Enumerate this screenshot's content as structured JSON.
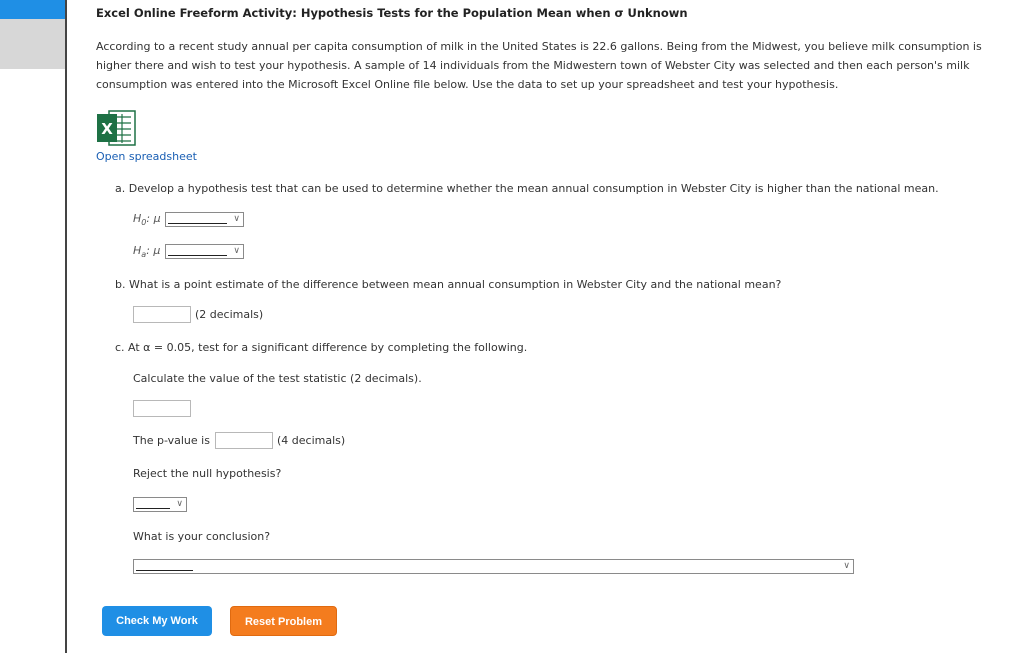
{
  "title": "Excel Online Freeform Activity: Hypothesis Tests for the Population Mean when σ Unknown",
  "intro": "According to a recent study annual per capita consumption of milk in the United States is 22.6 gallons. Being from the Midwest, you believe milk consumption is higher there and wish to test your hypothesis. A sample of 14 individuals from the Midwestern town of Webster City was selected and then each person's milk consumption was entered into the Microsoft Excel Online file below. Use the data to set up your spreadsheet and test your hypothesis.",
  "excel_icon": {
    "letter": "X",
    "icon": "excel-icon",
    "color": "#1e7145"
  },
  "open_link": "Open spreadsheet",
  "part_a": {
    "question": "a.  Develop a hypothesis test that can be used to determine whether the mean annual consumption in Webster City is higher than the national mean.",
    "h0_label": "H",
    "h0_sub": "0",
    "h0_suffix": ": μ",
    "ha_label": "H",
    "ha_sub": "a",
    "ha_suffix": ": μ"
  },
  "part_b": {
    "question": "b.  What is a point estimate of the difference between mean annual consumption in Webster City and the national mean?",
    "hint": "(2 decimals)"
  },
  "part_c": {
    "question": "c.  At α = 0.05, test for a significant difference by completing the following.",
    "test_stat_label": "Calculate the value of the test statistic (2 decimals).",
    "pvalue_prefix": "The p-value is",
    "pvalue_hint": "(4 decimals)",
    "reject_label": "Reject the null hypothesis?",
    "conclusion_label": "What is your conclusion?"
  },
  "buttons": {
    "check": "Check My Work",
    "reset": "Reset Problem"
  },
  "colors": {
    "primary": "#1f8fe5",
    "reset": "#f47c1e",
    "link": "#1a5fb4"
  }
}
